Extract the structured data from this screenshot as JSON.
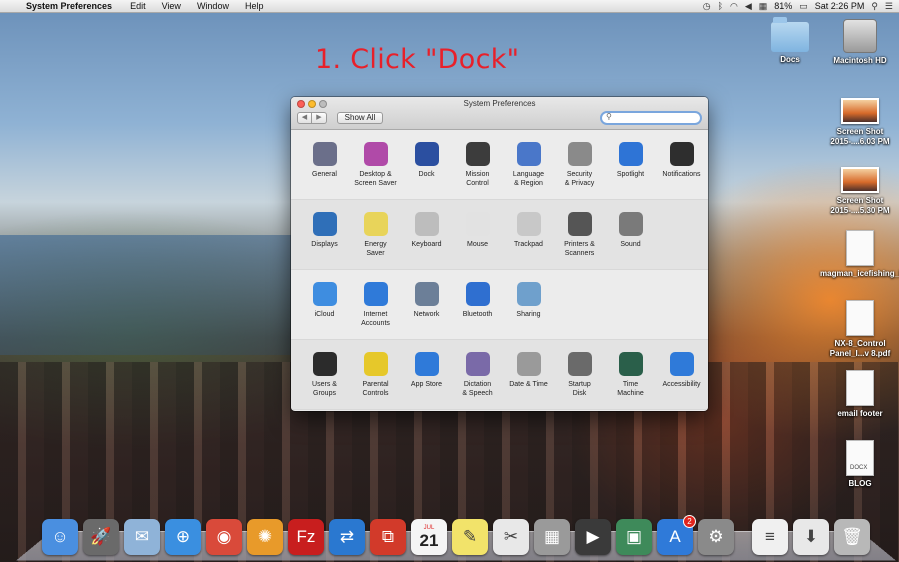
{
  "menubar": {
    "app_name": "System Preferences",
    "menus": [
      "Edit",
      "View",
      "Window",
      "Help"
    ],
    "battery": "81%",
    "clock": "Sat 2:26 PM"
  },
  "instruction": "1. Click \"Dock\"",
  "desktop": {
    "icons": [
      {
        "label": "Docs",
        "kind": "folder"
      },
      {
        "label": "Macintosh HD",
        "kind": "drive"
      },
      {
        "label": "Screen Shot 2015-....6.03 PM",
        "kind": "screenshot"
      },
      {
        "label": "Screen Shot 2015-....5.30 PM",
        "kind": "screenshot"
      },
      {
        "label": "magman_icefishing_kijiji",
        "kind": "document"
      },
      {
        "label": "NX-8_Control Panel_I...v 8.pdf",
        "kind": "pdf"
      },
      {
        "label": "email footer",
        "kind": "document"
      },
      {
        "label": "BLOG",
        "kind": "docx",
        "tag": "DOCX"
      }
    ]
  },
  "window": {
    "title": "System Preferences",
    "show_all_label": "Show All",
    "search_placeholder": "",
    "sections": [
      {
        "items": [
          {
            "label": "General",
            "icon": "general-icon",
            "color": "#6b6f8a"
          },
          {
            "label": "Desktop &\nScreen Saver",
            "icon": "desktop-icon",
            "color": "#b04aa8"
          },
          {
            "label": "Dock",
            "icon": "dock-icon",
            "color": "#2b4fa0"
          },
          {
            "label": "Mission\nControl",
            "icon": "mission-control-icon",
            "color": "#3c3c3c"
          },
          {
            "label": "Language\n& Region",
            "icon": "flag-icon",
            "color": "#4a77c9"
          },
          {
            "label": "Security\n& Privacy",
            "icon": "house-lock-icon",
            "color": "#8a8a8a"
          },
          {
            "label": "Spotlight",
            "icon": "spotlight-icon",
            "color": "#2e74d6"
          },
          {
            "label": "Notifications",
            "icon": "notifications-icon",
            "color": "#2e2e2e"
          }
        ]
      },
      {
        "items": [
          {
            "label": "Displays",
            "icon": "display-icon",
            "color": "#2f6fb8"
          },
          {
            "label": "Energy\nSaver",
            "icon": "lightbulb-icon",
            "color": "#e8d45a"
          },
          {
            "label": "Keyboard",
            "icon": "keyboard-icon",
            "color": "#bdbdbd"
          },
          {
            "label": "Mouse",
            "icon": "mouse-icon",
            "color": "#e2e2e2"
          },
          {
            "label": "Trackpad",
            "icon": "trackpad-icon",
            "color": "#c8c8c8"
          },
          {
            "label": "Printers &\nScanners",
            "icon": "printer-icon",
            "color": "#555555"
          },
          {
            "label": "Sound",
            "icon": "speaker-icon",
            "color": "#7a7a7a"
          }
        ]
      },
      {
        "items": [
          {
            "label": "iCloud",
            "icon": "cloud-icon",
            "color": "#3e8de0"
          },
          {
            "label": "Internet\nAccounts",
            "icon": "at-icon",
            "color": "#2f7ad9"
          },
          {
            "label": "Network",
            "icon": "globe-icon",
            "color": "#6c7f98"
          },
          {
            "label": "Bluetooth",
            "icon": "bluetooth-icon",
            "color": "#2f6fd0"
          },
          {
            "label": "Sharing",
            "icon": "sharing-folder-icon",
            "color": "#6fa0cc"
          }
        ]
      },
      {
        "items": [
          {
            "label": "Users &\nGroups",
            "icon": "users-icon",
            "color": "#2b2b2b"
          },
          {
            "label": "Parental\nControls",
            "icon": "parental-icon",
            "color": "#e6c82a"
          },
          {
            "label": "App Store",
            "icon": "app-store-icon",
            "color": "#2f7ad9"
          },
          {
            "label": "Dictation\n& Speech",
            "icon": "microphone-icon",
            "color": "#7a6aa8"
          },
          {
            "label": "Date & Time",
            "icon": "clock-icon",
            "color": "#9a9a9a"
          },
          {
            "label": "Startup\nDisk",
            "icon": "startup-disk-icon",
            "color": "#6a6a6a"
          },
          {
            "label": "Time\nMachine",
            "icon": "time-machine-icon",
            "color": "#2a5f4a"
          },
          {
            "label": "Accessibility",
            "icon": "accessibility-icon",
            "color": "#2f7ad9"
          }
        ]
      }
    ]
  },
  "dock": {
    "calendar_month": "JUL",
    "calendar_day": "21",
    "app_store_badge": "2",
    "items": [
      {
        "name": "finder-icon",
        "color": "#4a8fe0",
        "glyph": "☺"
      },
      {
        "name": "launchpad-icon",
        "color": "#6a6a6a",
        "glyph": "🚀"
      },
      {
        "name": "mail-icon",
        "color": "#8fb3d8",
        "glyph": "✉"
      },
      {
        "name": "safari-icon",
        "color": "#3a8fe0",
        "glyph": "⊕"
      },
      {
        "name": "chrome-icon",
        "color": "#d94a3a",
        "glyph": "◉"
      },
      {
        "name": "photos-wheel-icon",
        "color": "#e89a2a",
        "glyph": "✺"
      },
      {
        "name": "filezilla-icon",
        "color": "#c81e1e",
        "glyph": "Fz"
      },
      {
        "name": "teamviewer-icon",
        "color": "#2a78d0",
        "glyph": "⇄"
      },
      {
        "name": "screen-sharing-icon",
        "color": "#d23a2a",
        "glyph": "⧉"
      },
      {
        "name": "calendar-icon",
        "color": "#f5f5f5",
        "glyph": ""
      },
      {
        "name": "stickies-icon",
        "color": "#f2e36a",
        "glyph": "✎"
      },
      {
        "name": "preview-icon",
        "color": "#e8e8e8",
        "glyph": "✂"
      },
      {
        "name": "calculator-icon",
        "color": "#9a9a9a",
        "glyph": "▦"
      },
      {
        "name": "facetime-icon",
        "color": "#3a3a3a",
        "glyph": "▶"
      },
      {
        "name": "iphoto-icon",
        "color": "#3e8a5a",
        "glyph": "▣"
      },
      {
        "name": "app-store-dock-icon",
        "color": "#2f7ad9",
        "glyph": "A"
      },
      {
        "name": "system-preferences-icon",
        "color": "#8a8a8a",
        "glyph": "⚙"
      },
      {
        "name": "document-stack-icon",
        "color": "#f0f0f0",
        "glyph": "≡"
      },
      {
        "name": "downloads-stack-icon",
        "color": "#e8e8e8",
        "glyph": "⬇"
      },
      {
        "name": "trash-icon",
        "color": "#b8b8b8",
        "glyph": "🗑"
      }
    ]
  }
}
